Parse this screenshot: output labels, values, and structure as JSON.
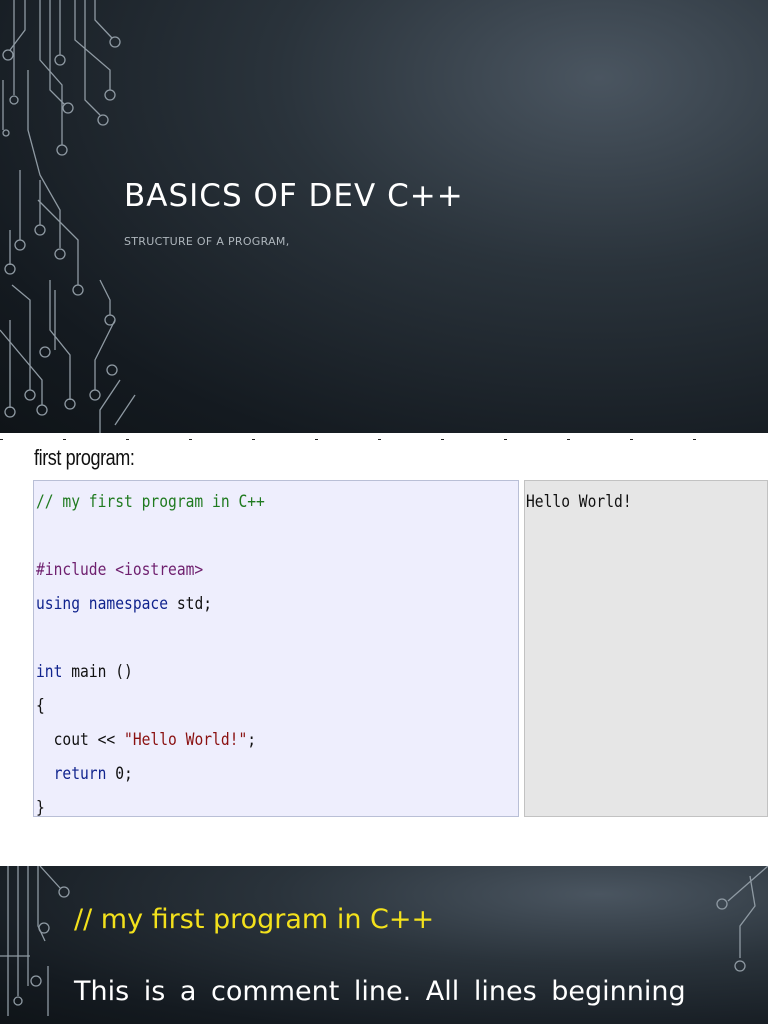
{
  "slide1": {
    "title": "BASICS OF DEV C++",
    "subtitle": "STRUCTURE OF A PROGRAM,"
  },
  "slide2": {
    "intro_text": "first program:",
    "code_lines": [
      {
        "text": "// my first program in C++",
        "kind": "comment"
      },
      {
        "text": "",
        "kind": "plain"
      },
      {
        "text": "#include <iostream>",
        "kind": "pre"
      },
      {
        "text": "using namespace std;",
        "kind": "kw"
      },
      {
        "text": "",
        "kind": "plain"
      },
      {
        "text": "int main ()",
        "kind": "kw"
      },
      {
        "text": "{",
        "kind": "plain"
      },
      {
        "text": "  cout << \"Hello World!\";",
        "kind": "plain"
      },
      {
        "text": "  return 0;",
        "kind": "kw"
      },
      {
        "text": "}",
        "kind": "plain"
      }
    ],
    "output": "Hello World!"
  },
  "slide3": {
    "heading": "// my first program in C++",
    "body": "This is a comment line. All lines beginning"
  },
  "colors": {
    "heading_yellow": "#f3e11c",
    "comment_green": "#1f7a1f",
    "keyword_blue": "#11248e",
    "string_red": "#8a1010",
    "code_bg": "#eeeefd",
    "output_bg": "#e6e6e6"
  }
}
